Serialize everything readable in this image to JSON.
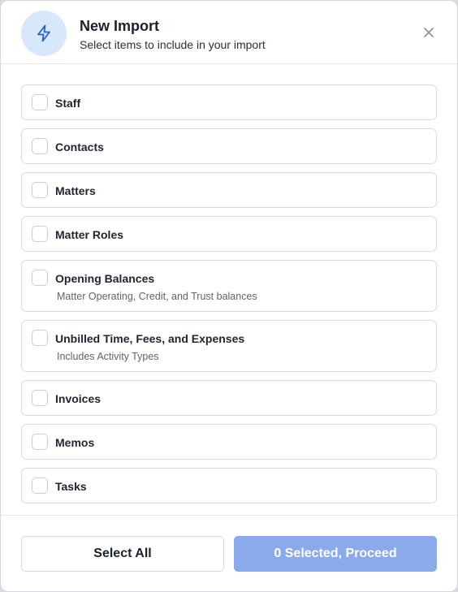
{
  "dialog": {
    "title": "New Import",
    "subtitle": "Select items to include in your import",
    "icon": "lightning-icon",
    "close_icon": "close-icon"
  },
  "items": [
    {
      "label": "Staff",
      "description": "",
      "checked": false
    },
    {
      "label": "Contacts",
      "description": "",
      "checked": false
    },
    {
      "label": "Matters",
      "description": "",
      "checked": false
    },
    {
      "label": "Matter Roles",
      "description": "",
      "checked": false
    },
    {
      "label": "Opening Balances",
      "description": "Matter Operating, Credit, and Trust balances",
      "checked": false
    },
    {
      "label": "Unbilled Time, Fees, and Expenses",
      "description": "Includes Activity Types",
      "checked": false
    },
    {
      "label": "Invoices",
      "description": "",
      "checked": false
    },
    {
      "label": "Memos",
      "description": "",
      "checked": false
    },
    {
      "label": "Tasks",
      "description": "",
      "checked": false
    }
  ],
  "footer": {
    "select_all_label": "Select All",
    "proceed_label": "0 Selected, Proceed"
  },
  "colors": {
    "accent_light": "#d8e8fb",
    "accent_icon": "#2563c9",
    "proceed_disabled": "#8aaaec"
  }
}
